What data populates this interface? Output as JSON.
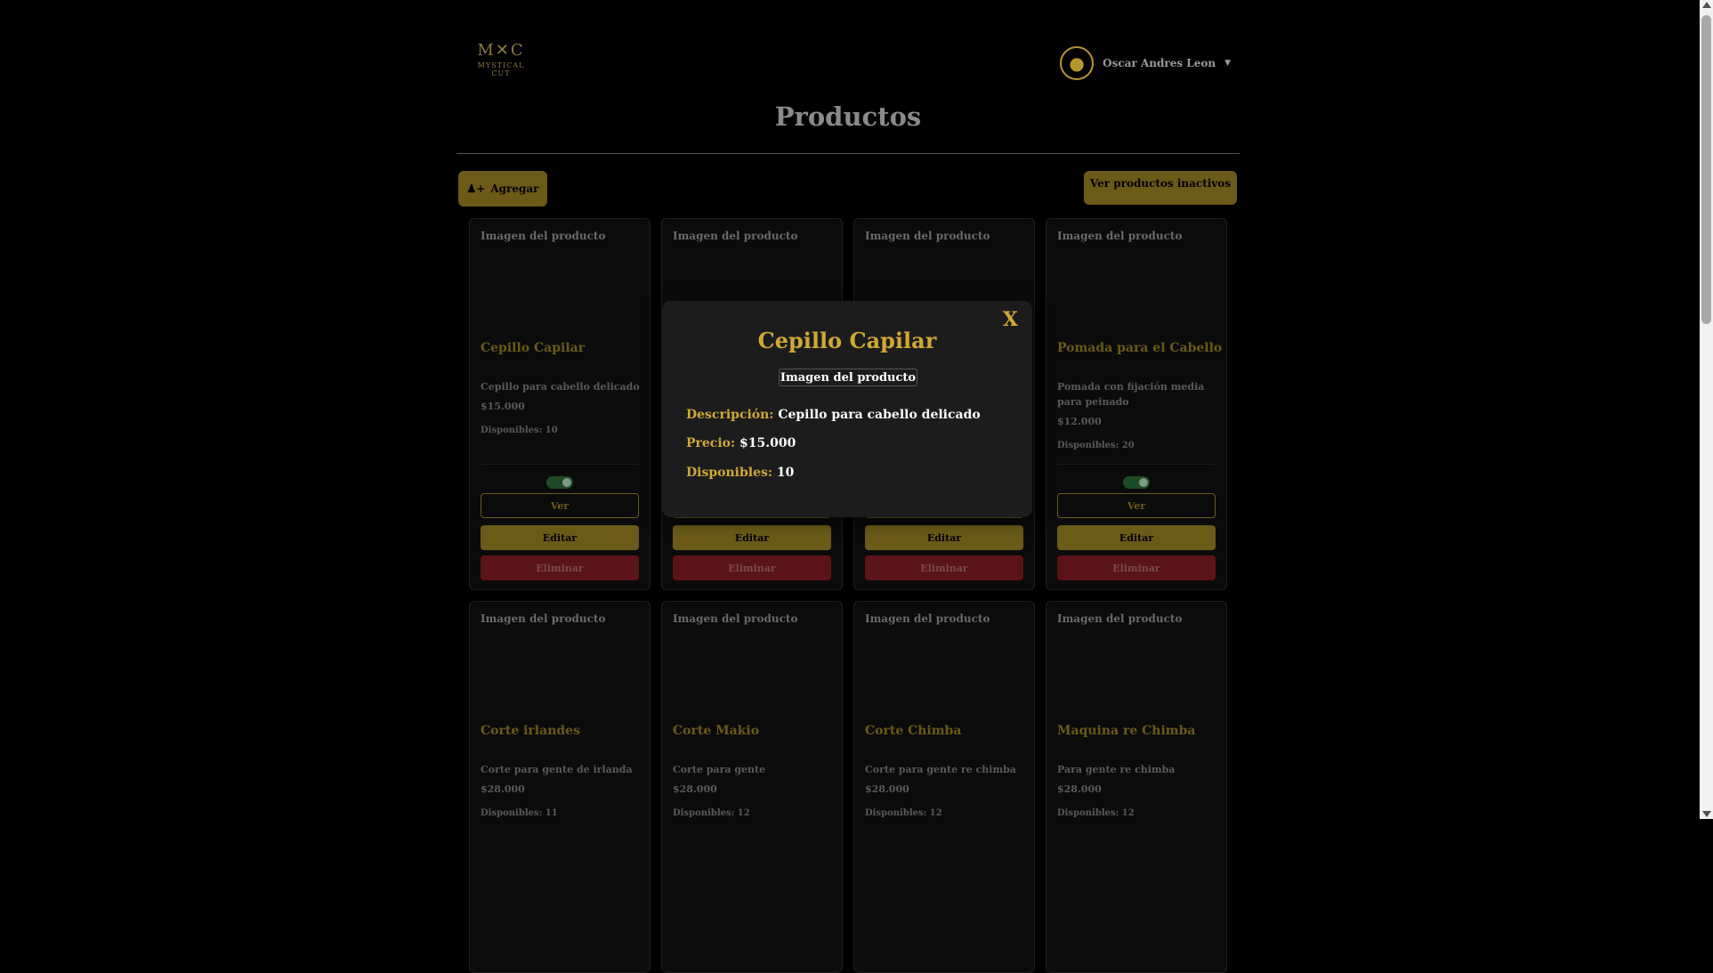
{
  "logo": {
    "mark": "M✕C",
    "text": "MYSTICAL CUT"
  },
  "user": {
    "name": "Oscar Andres Leon"
  },
  "page_title": "Productos",
  "actions": {
    "add_label": "Agregar",
    "inactive_label": "Ver productos inactivos"
  },
  "image_alt": "Imagen del producto",
  "buttons": {
    "view": "Ver",
    "edit": "Editar",
    "delete": "Eliminar"
  },
  "products": [
    {
      "name": "Cepillo Capilar",
      "description": "Cepillo para cabello delicado",
      "price": "$15.000",
      "stock": "Disponibles: 10",
      "active": true
    },
    {
      "name": "",
      "description": "",
      "price": "",
      "stock": "",
      "active": true
    },
    {
      "name": "",
      "description": "",
      "price": "",
      "stock": "",
      "active": true
    },
    {
      "name": "Pomada para el Cabello",
      "description": "Pomada con fijación media para peinado",
      "price": "$12.000",
      "stock": "Disponibles: 20",
      "active": true
    },
    {
      "name": "Corte irlandes",
      "description": "Corte para gente de irlanda",
      "price": "$28.000",
      "stock": "Disponibles: 11"
    },
    {
      "name": "Corte Makio",
      "description": "Corte para gente",
      "price": "$28.000",
      "stock": "Disponibles: 12"
    },
    {
      "name": "Corte Chimba",
      "description": "Corte para gente re chimba",
      "price": "$28.000",
      "stock": "Disponibles: 12"
    },
    {
      "name": "Maquina re Chimba",
      "description": "Para gente re chimba",
      "price": "$28.000",
      "stock": "Disponibles: 12"
    }
  ],
  "modal": {
    "close": "X",
    "title": "Cepillo Capilar",
    "image_alt": "Imagen del producto",
    "description_label": "Descripción:",
    "description": "Cepillo para cabello delicado",
    "price_label": "Precio:",
    "price": "$15.000",
    "stock_label": "Disponibles:",
    "stock": "10"
  },
  "colors": {
    "accent": "#d1a835",
    "dim_accent": "#6b5a18",
    "danger": "#5a1418",
    "background": "#000000"
  }
}
